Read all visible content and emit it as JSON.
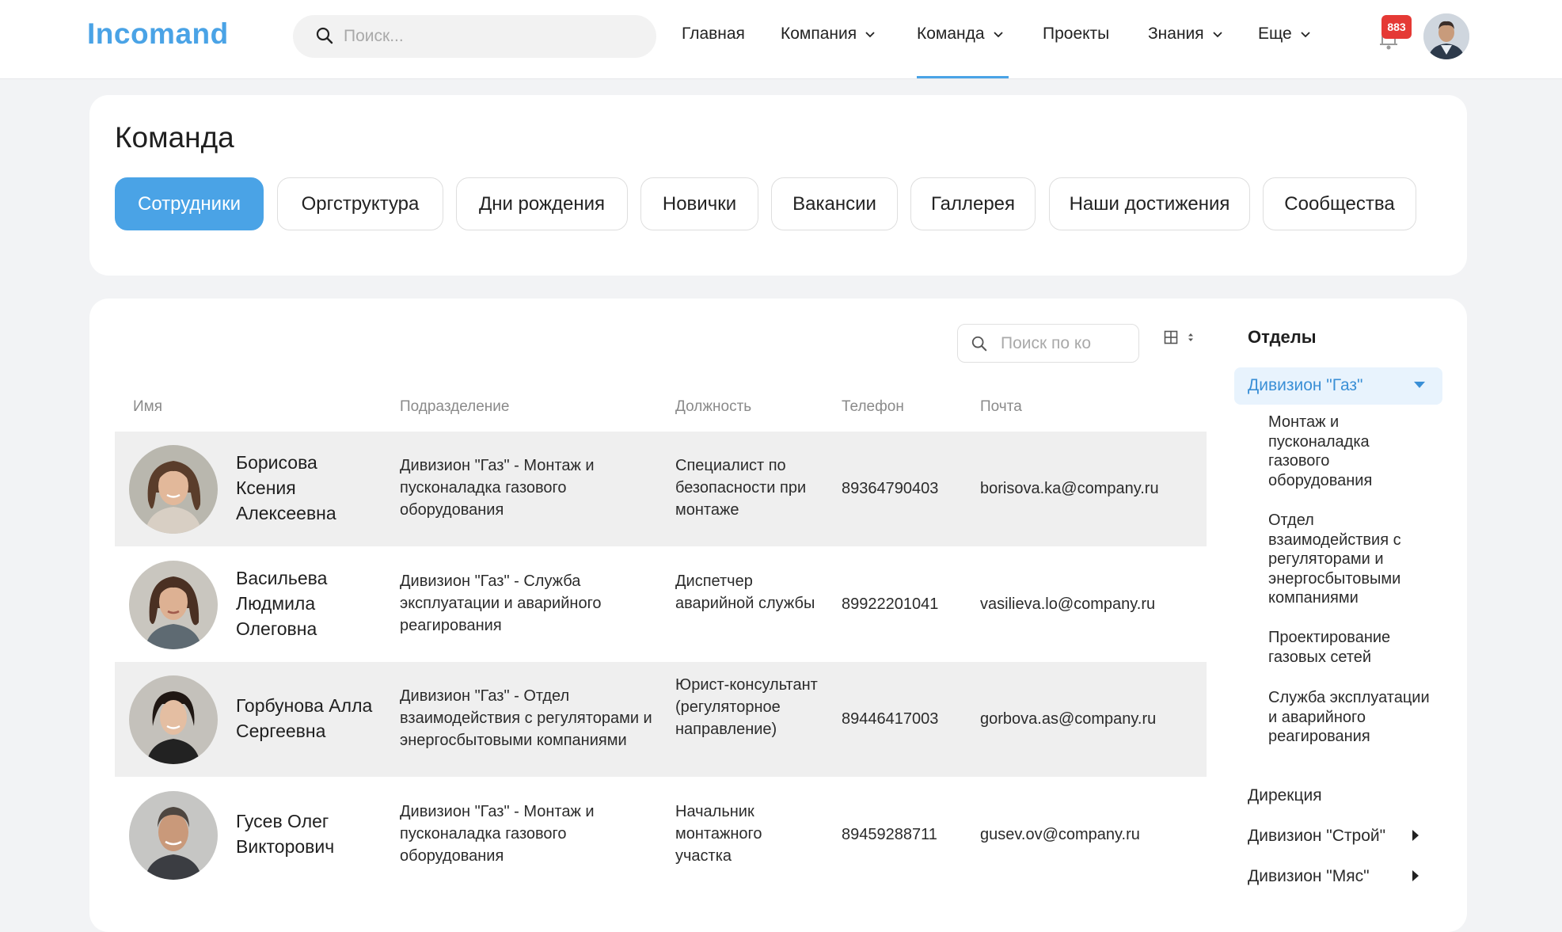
{
  "header": {
    "logo": "Incomand",
    "search_placeholder": "Поиск...",
    "nav": [
      {
        "label": "Главная",
        "dropdown": false
      },
      {
        "label": "Компания",
        "dropdown": true
      },
      {
        "label": "Команда",
        "dropdown": true,
        "active": true
      },
      {
        "label": "Проекты",
        "dropdown": false
      },
      {
        "label": "Знания",
        "dropdown": true
      },
      {
        "label": "Еще",
        "dropdown": true
      }
    ],
    "notifications_count": "883",
    "accent_color": "#4aa3e6"
  },
  "page": {
    "title": "Команда",
    "tabs": [
      {
        "label": "Сотрудники",
        "active": true
      },
      {
        "label": "Оргструктура"
      },
      {
        "label": "Дни рождения"
      },
      {
        "label": "Новички"
      },
      {
        "label": "Вакансии"
      },
      {
        "label": "Галлерея"
      },
      {
        "label": "Наши достижения"
      },
      {
        "label": "Сообщества"
      }
    ]
  },
  "table": {
    "search_placeholder": "Поиск по ко",
    "columns": [
      "Имя",
      "Подразделение",
      "Должность",
      "Телефон",
      "Почта"
    ],
    "rows": [
      {
        "name": "Борисова Ксения Алексеевна",
        "department": "Дивизион \"Газ\" - Монтаж и пусконаладка газового оборудования",
        "position": "Специалист по безопасности при монтаже",
        "phone": "89364790403",
        "email": "borisova.ka@company.ru"
      },
      {
        "name": "Васильева Людмила Олеговна",
        "department": "Дивизион \"Газ\" - Служба эксплуатации и аварийного реагирования",
        "position": "Диспетчер аварийной службы",
        "phone": "89922201041",
        "email": "vasilieva.lo@company.ru"
      },
      {
        "name": "Горбунова Алла Сергеевна",
        "department": "Дивизион \"Газ\" - Отдел взаимодействия с регуляторами и энергосбытовыми компаниями",
        "position": "Юрист-консультант (регуляторное направление)",
        "phone": "89446417003",
        "email": "gorbova.as@company.ru"
      },
      {
        "name": "Гусев Олег Викторович",
        "department": "Дивизион \"Газ\" - Монтаж и пусконаладка газового оборудования",
        "position": "Начальник монтажного участка",
        "phone": "89459288711",
        "email": "gusev.ov@company.ru"
      }
    ]
  },
  "departments": {
    "title": "Отделы",
    "active": "Дивизион \"Газ\"",
    "children": [
      "Монтаж и пусконаладка газового оборудования",
      "Отдел взаимодействия с регуляторами и энергосбытовыми компаниями",
      "Проектирование газовых сетей",
      "Служба эксплуатации и аварийного реагирования"
    ],
    "roots": [
      {
        "label": "Дирекция",
        "expandable": false
      },
      {
        "label": "Дивизион \"Строй\"",
        "expandable": true
      },
      {
        "label": "Дивизион \"Мяс\"",
        "expandable": true
      }
    ]
  }
}
